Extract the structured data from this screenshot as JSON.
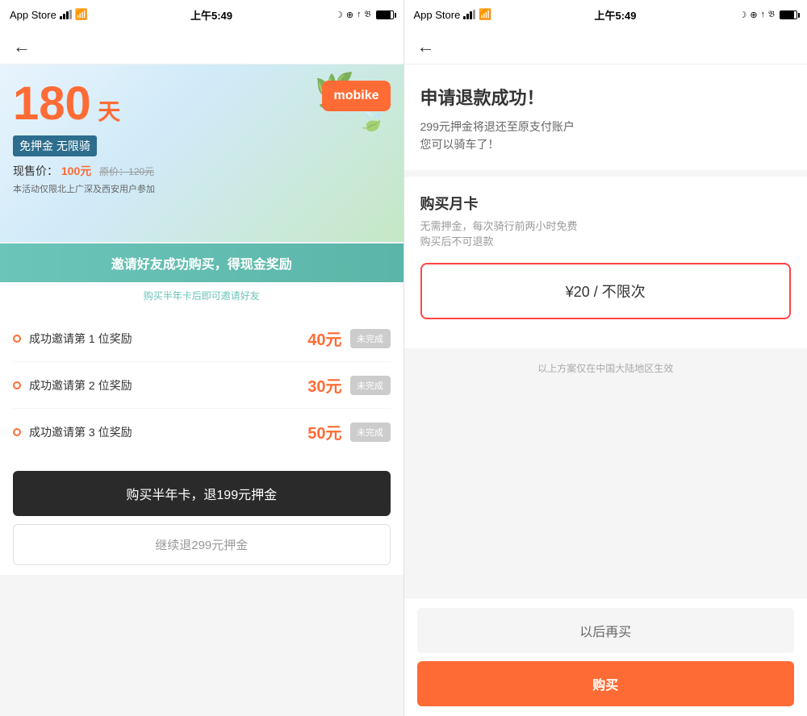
{
  "left": {
    "statusBar": {
      "carrier": "App Store",
      "signal": "●●●",
      "wifi": "WiFi",
      "time": "上午5:49",
      "batteryPct": 85
    },
    "nav": {
      "back": "←"
    },
    "promo": {
      "days": "180",
      "daysUnit": "天",
      "badge": "免押金 无限骑",
      "currentPriceLabel": "现售价：",
      "currentPrice": "100元",
      "originalPrice": "原价：120元",
      "note": "本活动仅限北上广深及西安用户参加",
      "logoText": "mobike"
    },
    "inviteBanner": {
      "text": "邀请好友成功购买，得现金奖励",
      "subText": "购买半年卡后即可邀请好友"
    },
    "rewards": [
      {
        "text": "成功邀请第 1 位奖励",
        "amount": "40元",
        "status": "未完成"
      },
      {
        "text": "成功邀请第 2 位奖励",
        "amount": "30元",
        "status": "未完成"
      },
      {
        "text": "成功邀请第 3 位奖励",
        "amount": "50元",
        "status": "未完成"
      }
    ],
    "buttons": {
      "primary": "购买半年卡，退199元押金",
      "secondary": "继续退299元押金"
    }
  },
  "right": {
    "statusBar": {
      "carrier": "App Store",
      "signal": "●●●",
      "wifi": "WiFi",
      "time": "上午5:49",
      "batteryPct": 85
    },
    "nav": {
      "back": "←"
    },
    "success": {
      "title": "申请退款成功！",
      "desc1": "299元押金将退还至原支付账户",
      "desc2": "您可以骑车了！"
    },
    "monthly": {
      "title": "购买月卡",
      "desc": "无需押金，每次骑行前两小时免费\n购买后不可退款",
      "priceOption": "¥20 / 不限次"
    },
    "notice": "以上方案仅在中国大陆地区生效",
    "buttons": {
      "secondary": "以后再买",
      "primary": "购买"
    }
  }
}
